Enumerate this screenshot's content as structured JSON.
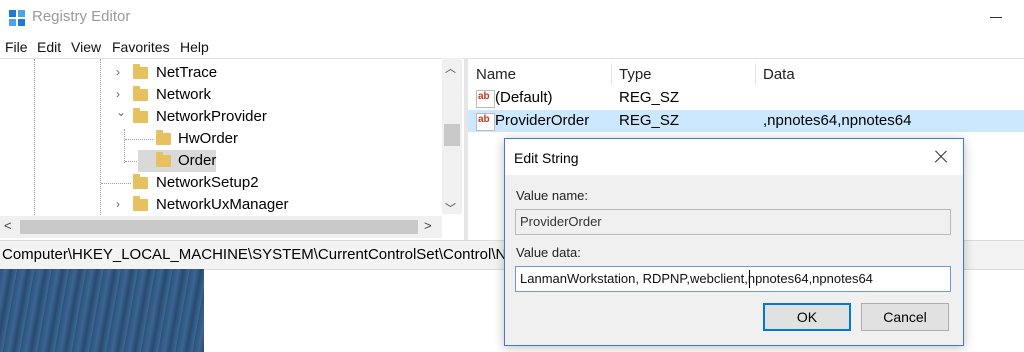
{
  "window": {
    "title": "Registry Editor",
    "icon": "registry-editor-icon"
  },
  "menu": [
    "File",
    "Edit",
    "View",
    "Favorites",
    "Help"
  ],
  "tree": {
    "items": [
      {
        "label": "NetTrace",
        "chevron": "›"
      },
      {
        "label": "Network",
        "chevron": "›"
      },
      {
        "label": "NetworkProvider",
        "chevron": "⌄"
      },
      {
        "label": "HwOrder",
        "chevron": ""
      },
      {
        "label": "Order",
        "chevron": ""
      },
      {
        "label": "NetworkSetup2",
        "chevron": "›"
      },
      {
        "label": "NetworkUxManager",
        "chevron": "›"
      }
    ],
    "selected": "Order"
  },
  "list": {
    "columns": [
      "Name",
      "Type",
      "Data"
    ],
    "rows": [
      {
        "name": "(Default)",
        "type": "REG_SZ",
        "data": ""
      },
      {
        "name": "ProviderOrder",
        "type": "REG_SZ",
        "data": ",npnotes64,npnotes64"
      }
    ]
  },
  "address": "Computer\\HKEY_LOCAL_MACHINE\\SYSTEM\\CurrentControlSet\\Control\\Network",
  "dialog": {
    "title": "Edit String",
    "value_name_label": "Value name:",
    "value_name": "ProviderOrder",
    "value_data_label": "Value data:",
    "value_data": "LanmanWorkstation, RDPNP,webclient,npnotes64,npnotes64",
    "ok": "OK",
    "cancel": "Cancel"
  },
  "colors": {
    "selection": "#cce8ff",
    "dialog_border": "#3f7bd0",
    "ok_border": "#0078d7",
    "folder": "#e8c15f"
  }
}
